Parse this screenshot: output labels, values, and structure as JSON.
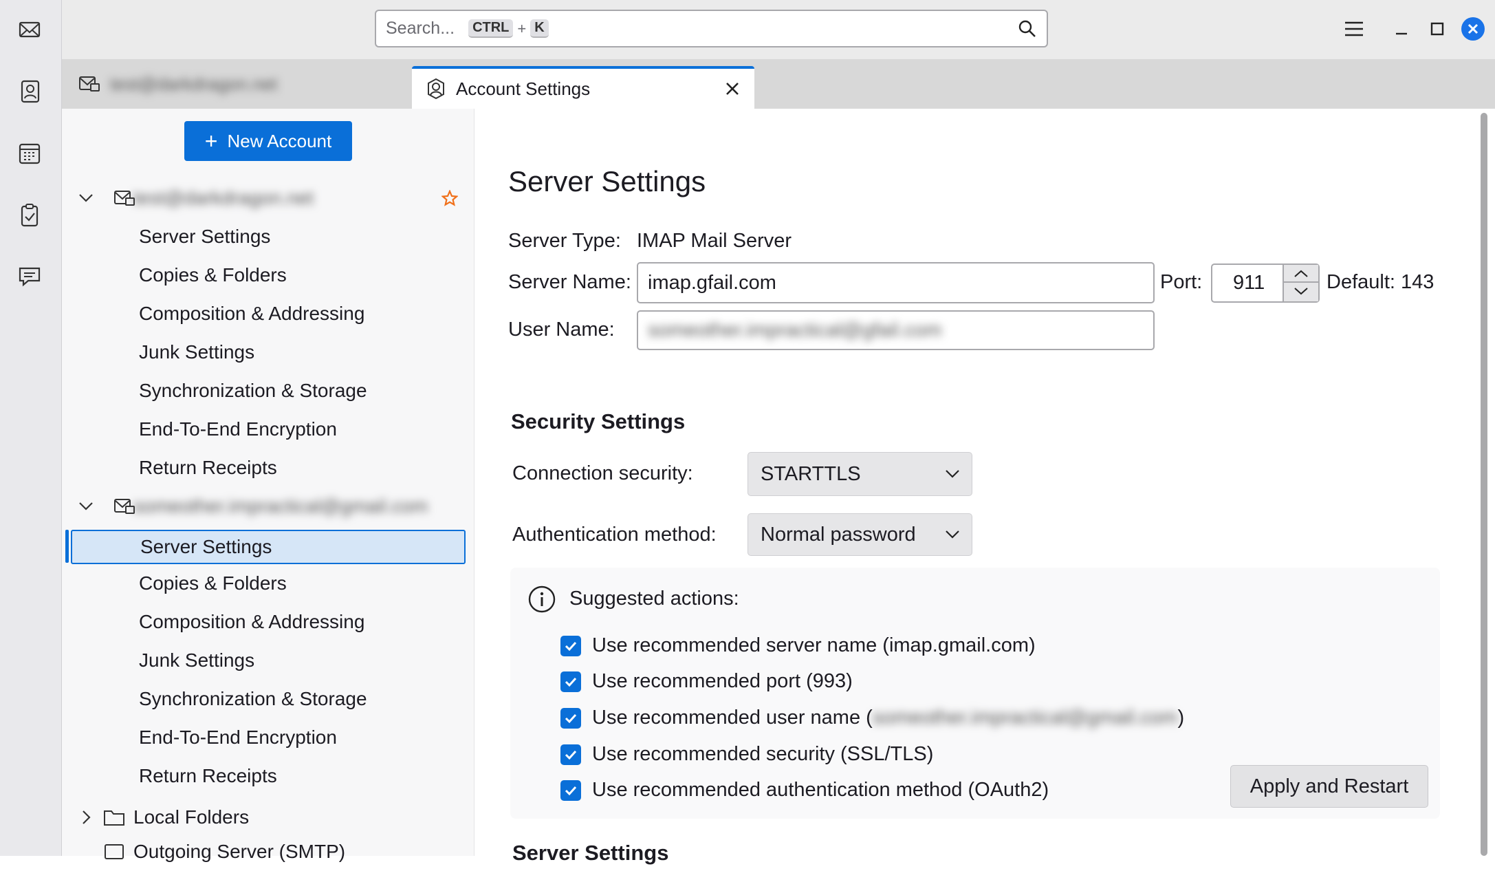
{
  "window": {
    "search_placeholder": "Search...",
    "shortcut_key1": "CTRL",
    "shortcut_plus": "+",
    "shortcut_key2": "K"
  },
  "spaces": [
    "mail-icon",
    "address-book-icon",
    "calendar-icon",
    "tasks-icon",
    "chat-icon"
  ],
  "tabs": [
    {
      "label": "test@darkdragon.net",
      "icon": "mail-lock-icon",
      "blurred": true
    },
    {
      "label": "Account Settings",
      "icon": "account-icon",
      "active": true
    }
  ],
  "sidebar": {
    "new_account": "New Account",
    "accounts": [
      {
        "name": "test@darkdragon.net",
        "blurred": true,
        "default": true,
        "items": [
          "Server Settings",
          "Copies & Folders",
          "Composition & Addressing",
          "Junk Settings",
          "Synchronization & Storage",
          "End-To-End Encryption",
          "Return Receipts"
        ]
      },
      {
        "name": "someother.impractical@gmail.com",
        "blurred": true,
        "items": [
          "Server Settings",
          "Copies & Folders",
          "Composition & Addressing",
          "Junk Settings",
          "Synchronization & Storage",
          "End-To-End Encryption",
          "Return Receipts"
        ],
        "selected": "Server Settings"
      }
    ],
    "local_folders": "Local Folders",
    "outgoing": "Outgoing Server (SMTP)"
  },
  "main": {
    "title": "Server Settings",
    "server_type_label": "Server Type:",
    "server_type_value": "IMAP Mail Server",
    "server_name_label": "Server Name:",
    "server_name_value": "imap.gfail.com",
    "port_label": "Port:",
    "port_value": "911",
    "default_port": "Default: 143",
    "user_name_label": "User Name:",
    "user_name_value": "someother.impractical@gfail.com",
    "security_heading": "Security Settings",
    "connection_label": "Connection security:",
    "connection_value": "STARTTLS",
    "auth_label": "Authentication method:",
    "auth_value": "Normal password",
    "suggested_title": "Suggested actions:",
    "suggestions": [
      {
        "pre": "Use recommended server name (imap.gmail.com)",
        "checked": true
      },
      {
        "pre": "Use recommended port (993)",
        "checked": true
      },
      {
        "pre": "Use recommended user name (",
        "blur": "someother.impractical@gmail.com",
        "post": ")",
        "checked": true
      },
      {
        "pre": "Use recommended security (SSL/TLS)",
        "checked": true
      },
      {
        "pre": "Use recommended authentication method (OAuth2)",
        "checked": true
      }
    ],
    "apply_button": "Apply and Restart",
    "next_heading": "Server Settings"
  },
  "colors": {
    "accent": "#0a6fd8",
    "star": "#f0701a",
    "selected_bg": "#d6e6f7"
  }
}
